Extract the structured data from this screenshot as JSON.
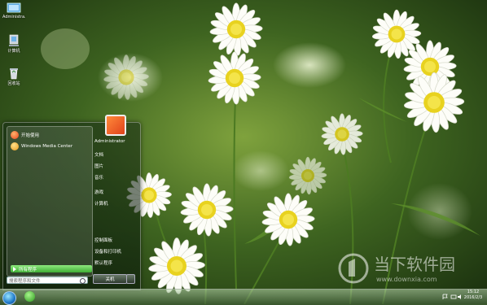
{
  "desktop": {
    "icons": [
      {
        "label": "Administra...",
        "icon": "user-folder-icon"
      },
      {
        "label": "计算机",
        "icon": "computer-icon"
      },
      {
        "label": "回收站",
        "icon": "recycle-bin-icon"
      }
    ]
  },
  "start_menu": {
    "pinned": [
      {
        "label": "开始使用",
        "color": "#e8401c"
      },
      {
        "label": "Windows Media Center",
        "color": "#e89a1c"
      }
    ],
    "all_programs": "所有程序",
    "search_placeholder": "搜索程序和文件",
    "right_items": [
      "Administrator",
      "文档",
      "图片",
      "音乐",
      "游戏",
      "计算机",
      "控制面板",
      "设备和打印机",
      "默认程序",
      "帮助和支持"
    ],
    "shutdown_label": "关机"
  },
  "taskbar": {
    "time": "15:12",
    "date": "2016/2/3"
  },
  "watermark": {
    "text": "当下软件园",
    "url": "www.downxia.com"
  }
}
